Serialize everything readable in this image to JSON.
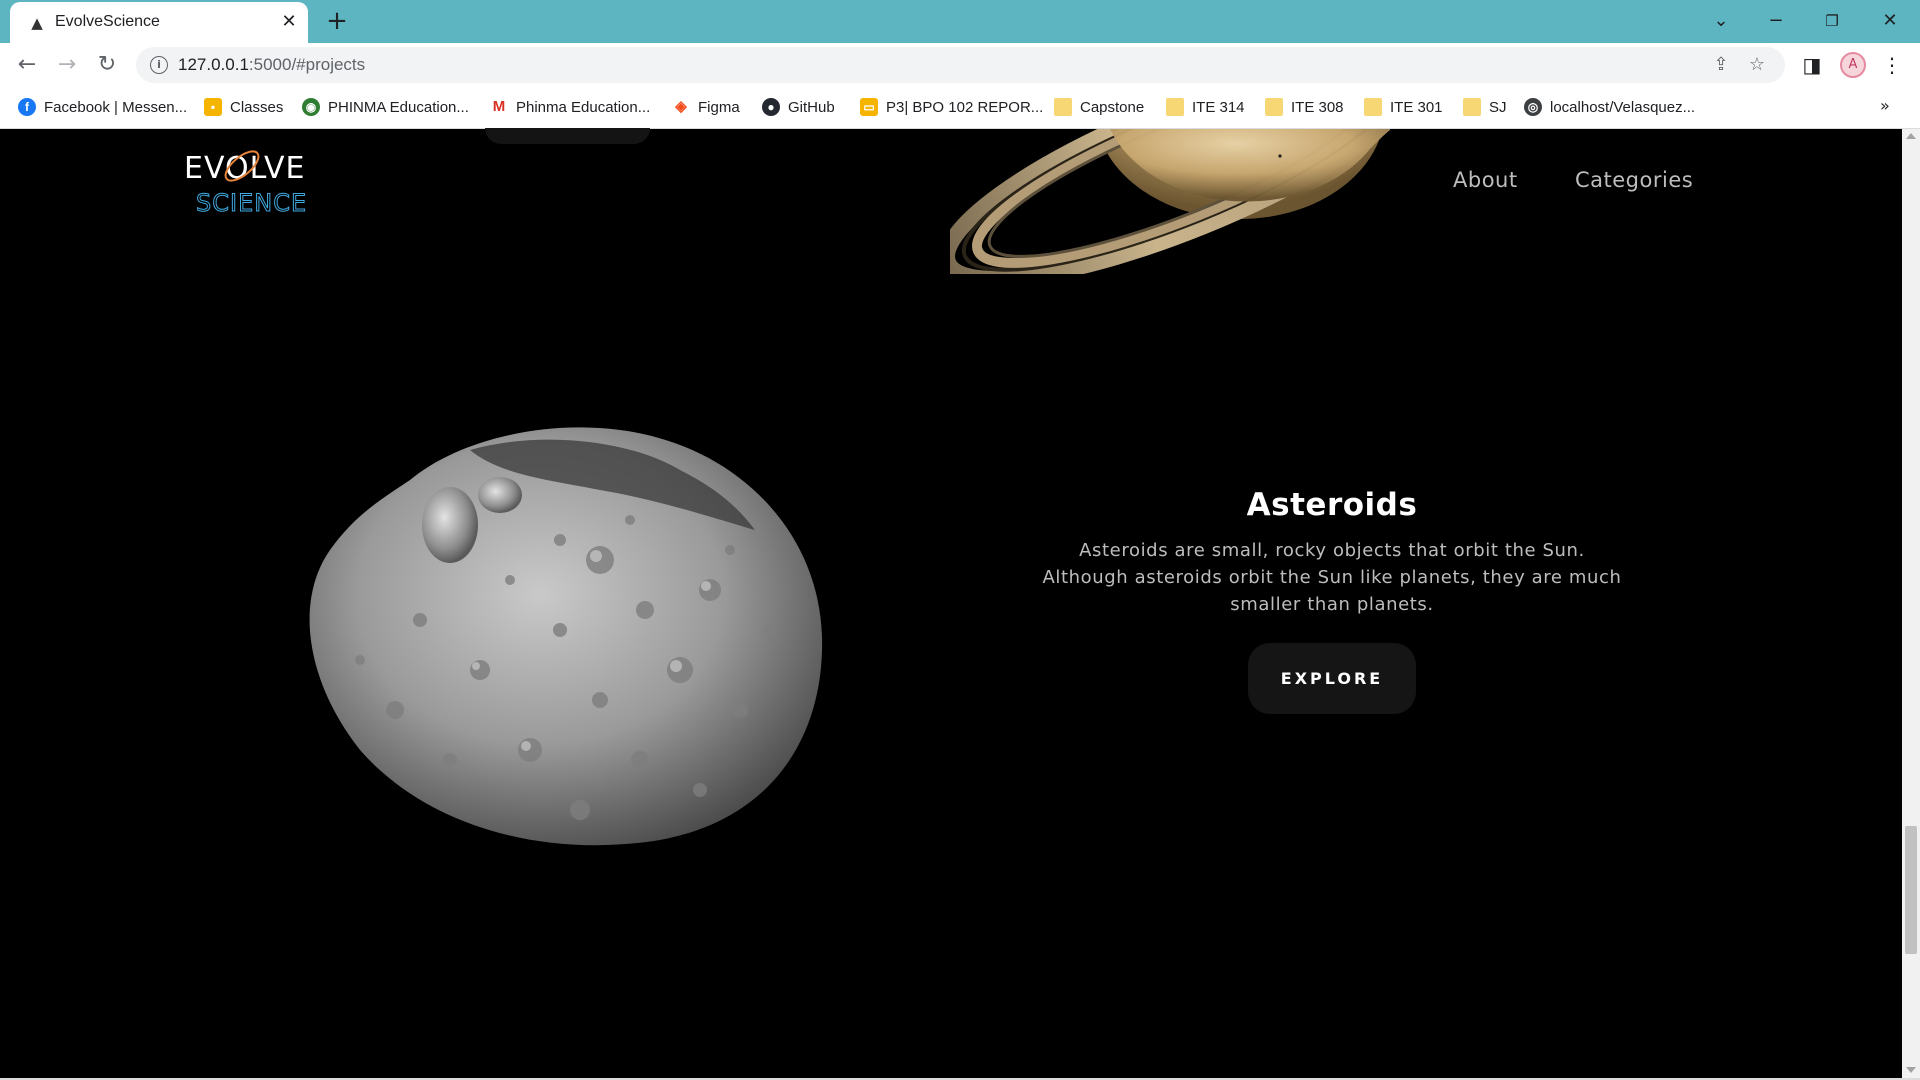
{
  "browser": {
    "tab_title": "EvolveScience",
    "tab_icon": "rocket-icon",
    "url_host": "127.0.0.1",
    "url_path": ":5000/#projects",
    "bookmarks": [
      {
        "label": "Facebook | Messen...",
        "icon": "facebook-icon"
      },
      {
        "label": "Classes",
        "icon": "classroom-icon"
      },
      {
        "label": "PHINMA Education...",
        "icon": "globe-icon"
      },
      {
        "label": "Phinma Education...",
        "icon": "gmail-icon"
      },
      {
        "label": "Figma",
        "icon": "figma-icon"
      },
      {
        "label": "GitHub",
        "icon": "github-icon"
      },
      {
        "label": "P3| BPO 102 REPOR...",
        "icon": "slides-icon"
      },
      {
        "label": "Capstone",
        "icon": "folder-icon"
      },
      {
        "label": "ITE 314",
        "icon": "folder-icon"
      },
      {
        "label": "ITE 308",
        "icon": "folder-icon"
      },
      {
        "label": "ITE 301",
        "icon": "folder-icon"
      },
      {
        "label": "SJ",
        "icon": "folder-icon"
      },
      {
        "label": "localhost/Velasquez...",
        "icon": "globe-icon"
      }
    ],
    "colors": {
      "tabstrip": "#5cb5c0"
    }
  },
  "site": {
    "logo_text_top": "EVOLVE",
    "logo_text_bottom": "SCIENCE",
    "nav": {
      "about": "About",
      "categories": "Categories"
    }
  },
  "section": {
    "title": "Asteroids",
    "description": "Asteroids are small, rocky objects that orbit the Sun. Although asteroids orbit the Sun like planets, they are much smaller than planets.",
    "button_label": "EXPLORE"
  },
  "colors": {
    "background": "#000000",
    "logo_top": "#ffffff",
    "logo_bottom": "#3fa9e0",
    "logo_swoosh": "#e8833a"
  }
}
